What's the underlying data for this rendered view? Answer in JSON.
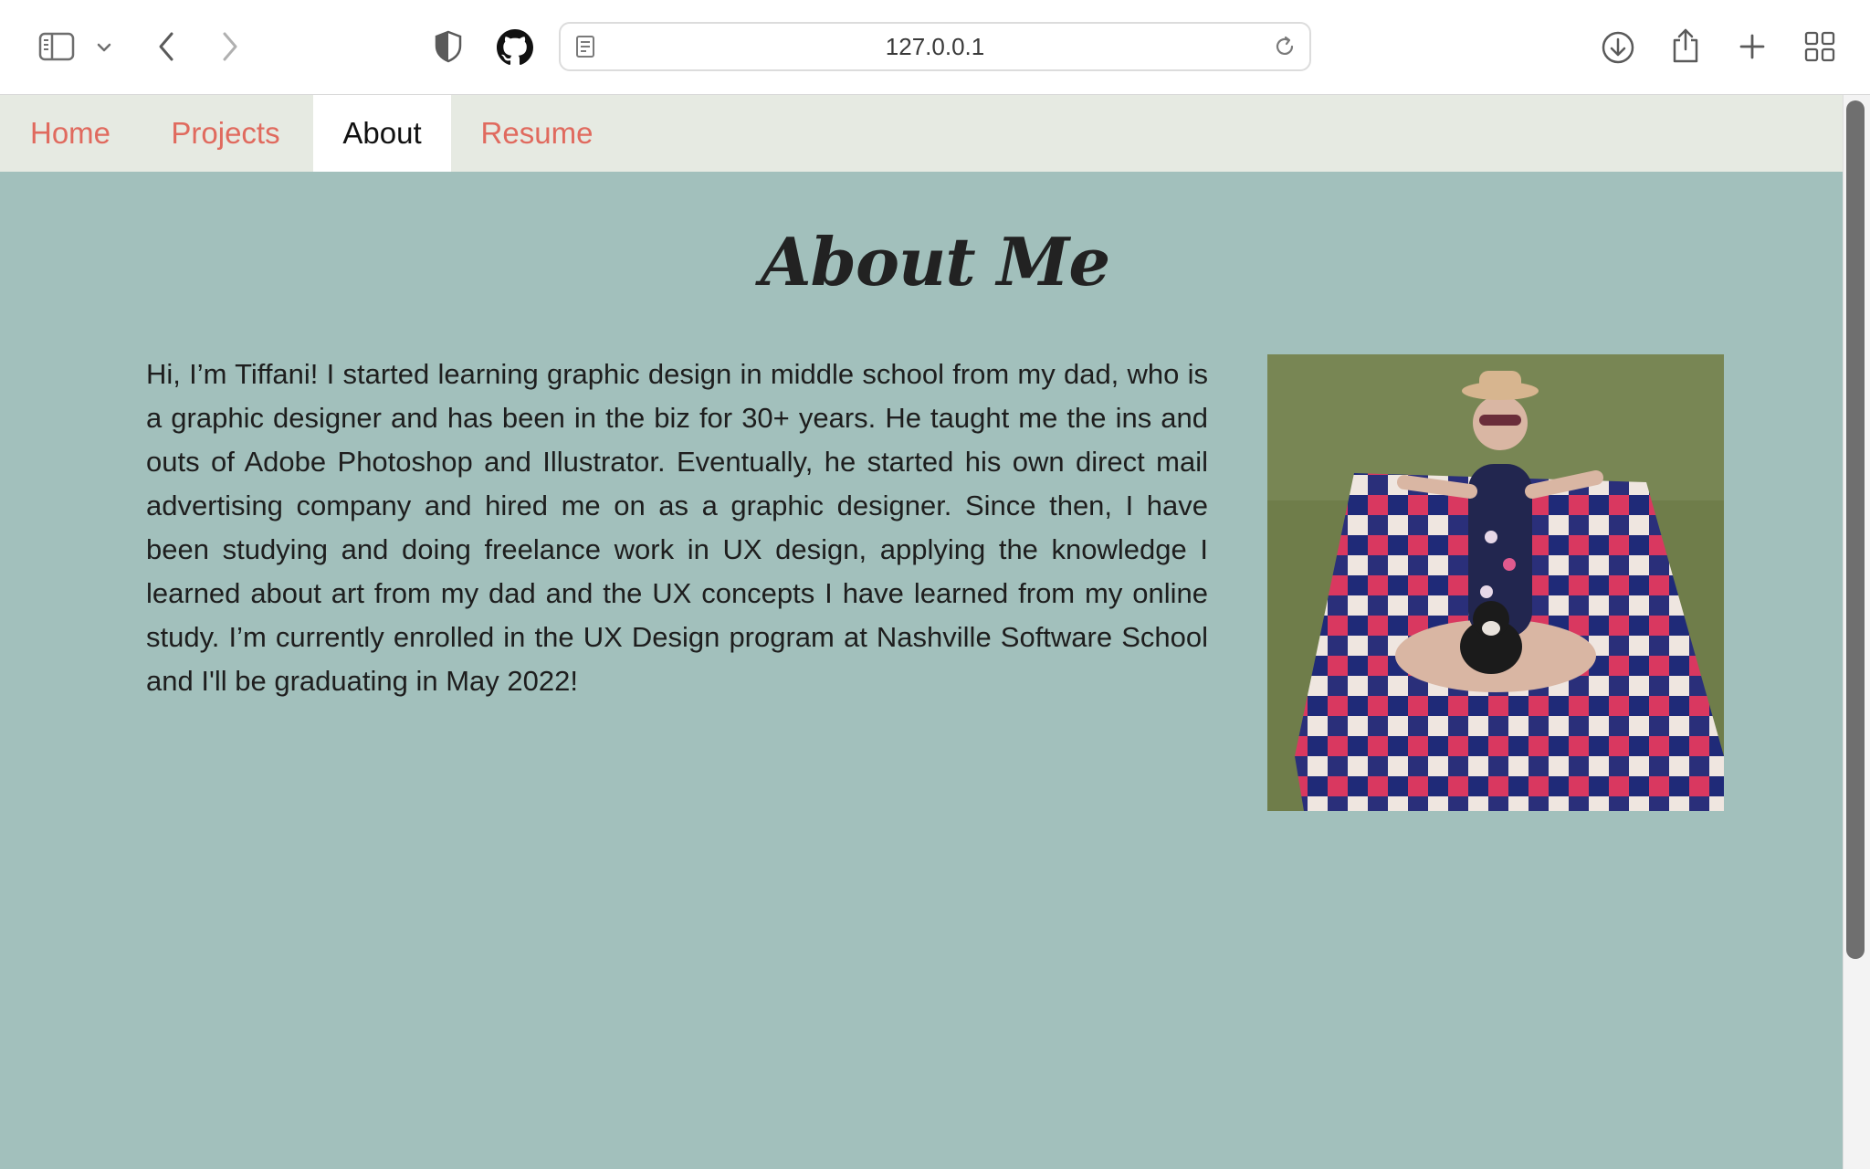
{
  "browser": {
    "url": "127.0.0.1"
  },
  "nav": {
    "items": [
      {
        "label": "Home",
        "active": false
      },
      {
        "label": "Projects",
        "active": false
      },
      {
        "label": "About",
        "active": true
      },
      {
        "label": "Resume",
        "active": false
      }
    ]
  },
  "about": {
    "heading": "About Me",
    "bio": "Hi, I’m Tiffani! I started learning graphic design in middle school from my dad, who is a graphic designer and has been in the biz for 30+ years. He taught me the ins and outs of Adobe Photoshop and Illustrator. Eventually, he started his own direct mail advertising company and hired me on as a graphic designer. Since then, I have been studying and doing freelance work in UX design, applying the knowledge I learned about art from my dad and the UX concepts I have learned from my online study. I’m currently enrolled in the UX Design program at Nashville Software School and I'll be graduating in May 2022!"
  },
  "colors": {
    "page_background": "#a2c0bc",
    "nav_background": "#e6eae2",
    "nav_link": "#e06a5e",
    "nav_active": "#ffffff"
  },
  "icons": [
    "sidebar-icon",
    "chevron-down-icon",
    "back-icon",
    "forward-icon",
    "shield-icon",
    "github-icon",
    "reader-icon",
    "reload-icon",
    "download-icon",
    "share-icon",
    "plus-icon",
    "tab-overview-icon"
  ]
}
